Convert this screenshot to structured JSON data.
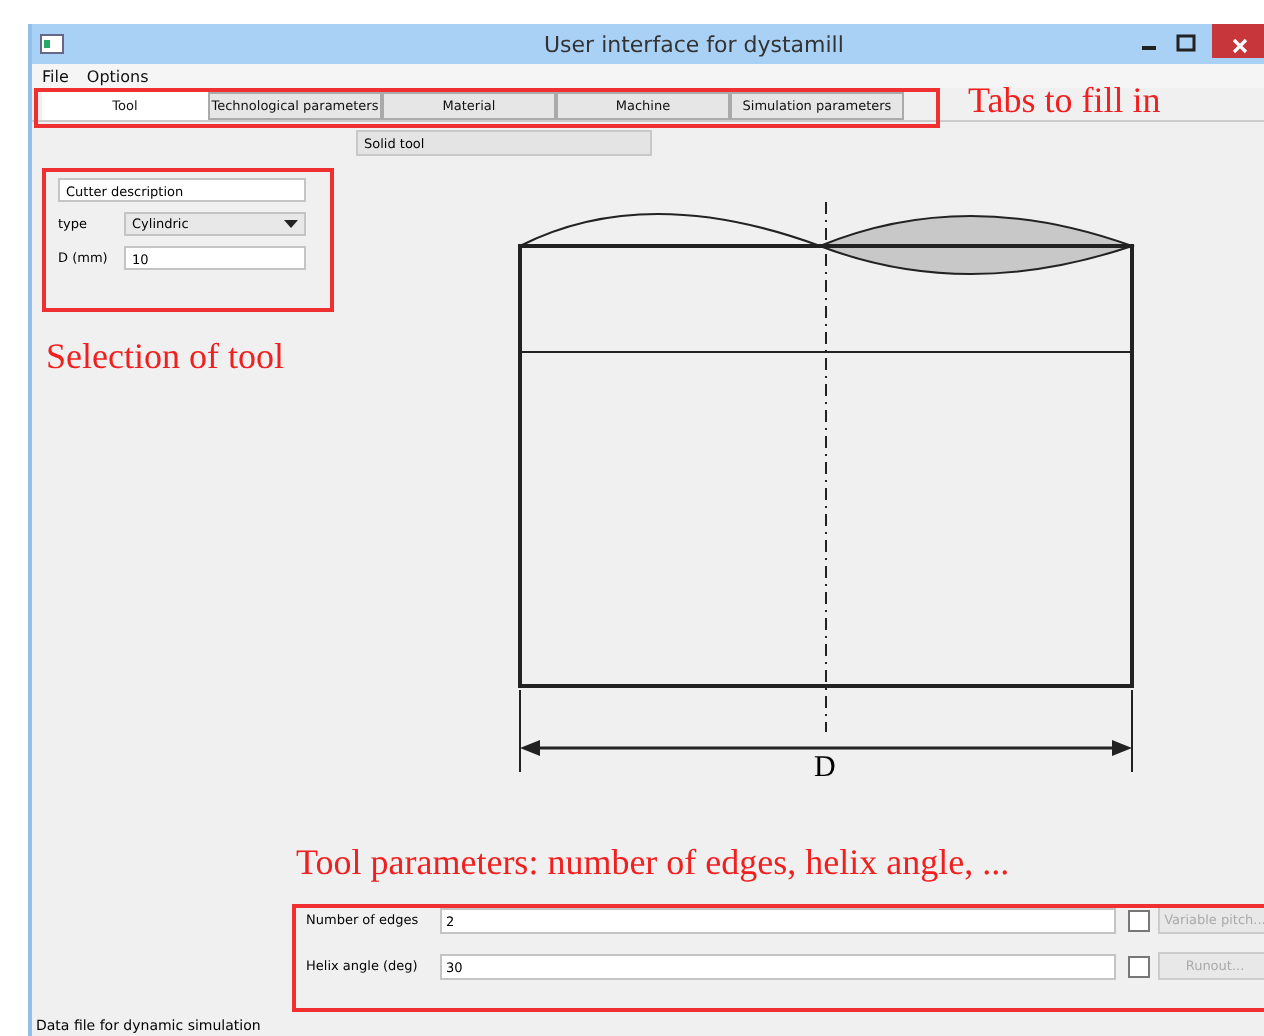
{
  "window": {
    "title": "User interface for dystamill"
  },
  "menu": [
    "File",
    "Options"
  ],
  "tabs": [
    {
      "label": "Tool",
      "selected": true
    },
    {
      "label": "Technological parameters",
      "selected": false
    },
    {
      "label": "Material",
      "selected": false
    },
    {
      "label": "Machine",
      "selected": false
    },
    {
      "label": "Simulation parameters",
      "selected": false
    }
  ],
  "section_header": "Solid tool",
  "tool_form": {
    "description": "Cutter description",
    "type_label": "type",
    "type_value": "Cylindric",
    "diameter_label": "D (mm)",
    "diameter_value": "10"
  },
  "drawing": {
    "dimension_label": "D"
  },
  "parameters": [
    {
      "label": "Number of edges",
      "value": "2",
      "checked": false,
      "button": "Variable pitch...",
      "disabled": true
    },
    {
      "label": "Helix angle (deg)",
      "value": "30",
      "checked": false,
      "button": "Runout...",
      "disabled": true
    }
  ],
  "status_text": "Data file for dynamic simulation",
  "annotations": {
    "tabs": "Tabs to fill in",
    "form": "Selection of tool",
    "parameters": "Tool parameters: number of edges, helix angle, ..."
  }
}
